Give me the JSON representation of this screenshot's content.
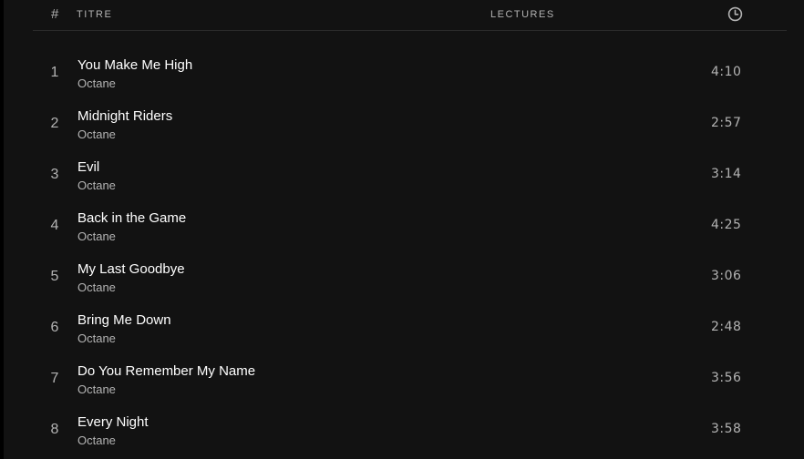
{
  "header": {
    "number": "#",
    "title": "TITRE",
    "plays": "LECTURES",
    "duration_icon": "clock-icon"
  },
  "tracks": [
    {
      "number": "1",
      "title": "You Make Me High",
      "artist": "Octane",
      "duration": "4:10"
    },
    {
      "number": "2",
      "title": "Midnight Riders",
      "artist": "Octane",
      "duration": "2:57"
    },
    {
      "number": "3",
      "title": "Evil",
      "artist": "Octane",
      "duration": "3:14"
    },
    {
      "number": "4",
      "title": "Back in the Game",
      "artist": "Octane",
      "duration": "4:25"
    },
    {
      "number": "5",
      "title": "My Last Goodbye",
      "artist": "Octane",
      "duration": "3:06"
    },
    {
      "number": "6",
      "title": "Bring Me Down",
      "artist": "Octane",
      "duration": "2:48"
    },
    {
      "number": "7",
      "title": "Do You Remember My Name",
      "artist": "Octane",
      "duration": "3:56"
    },
    {
      "number": "8",
      "title": "Every Night",
      "artist": "Octane",
      "duration": "3:58"
    }
  ],
  "colors": {
    "background": "#121212",
    "primary_text": "#ffffff",
    "secondary_text": "#b3b3b3",
    "divider": "#2a2a2a"
  }
}
